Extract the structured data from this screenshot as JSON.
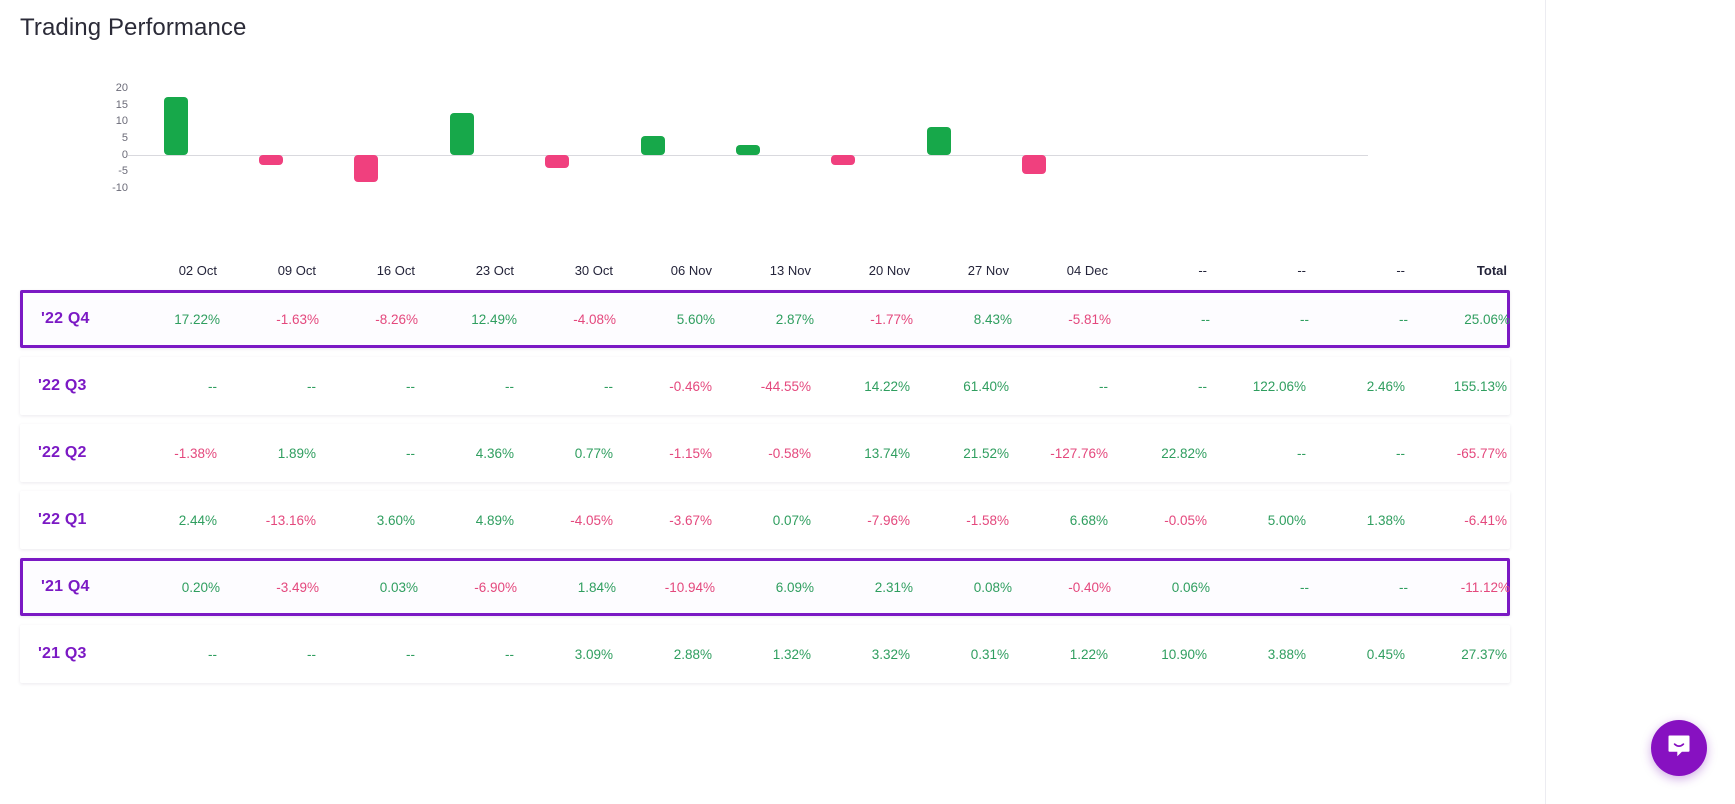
{
  "page": {
    "title": "Trading Performance"
  },
  "colors": {
    "positive": "#2f9e5f",
    "negative": "#e4487d",
    "bar_positive": "#17a84a",
    "bar_negative": "#f0407e",
    "accent_purple": "#7b19c4",
    "row_label": "#7b19c4",
    "intercom": "#8711c1"
  },
  "chat": {
    "launcher_icon": "chat-bubble-smile-icon"
  },
  "table": {
    "columns": [
      "02 Oct",
      "09 Oct",
      "16 Oct",
      "23 Oct",
      "30 Oct",
      "06 Nov",
      "13 Nov",
      "20 Nov",
      "27 Nov",
      "04 Dec",
      "--",
      "--",
      "--"
    ],
    "total_header": "Total",
    "na": "--",
    "rows": [
      {
        "label": "'22 Q4",
        "highlight": true,
        "values": [
          "17.22%",
          "-1.63%",
          "-8.26%",
          "12.49%",
          "-4.08%",
          "5.60%",
          "2.87%",
          "-1.77%",
          "8.43%",
          "-5.81%",
          "--",
          "--",
          "--"
        ],
        "total": "25.06%"
      },
      {
        "label": "'22 Q3",
        "highlight": false,
        "values": [
          "--",
          "--",
          "--",
          "--",
          "--",
          "-0.46%",
          "-44.55%",
          "14.22%",
          "61.40%",
          "--",
          "--",
          "122.06%",
          "2.46%"
        ],
        "total": "155.13%"
      },
      {
        "label": "'22 Q2",
        "highlight": false,
        "values": [
          "-1.38%",
          "1.89%",
          "--",
          "4.36%",
          "0.77%",
          "-1.15%",
          "-0.58%",
          "13.74%",
          "21.52%",
          "-127.76%",
          "22.82%",
          "--",
          "--"
        ],
        "total": "-65.77%"
      },
      {
        "label": "'22 Q1",
        "highlight": false,
        "values": [
          "2.44%",
          "-13.16%",
          "3.60%",
          "4.89%",
          "-4.05%",
          "-3.67%",
          "0.07%",
          "-7.96%",
          "-1.58%",
          "6.68%",
          "-0.05%",
          "5.00%",
          "1.38%"
        ],
        "total": "-6.41%"
      },
      {
        "label": "'21 Q4",
        "highlight": true,
        "values": [
          "0.20%",
          "-3.49%",
          "0.03%",
          "-6.90%",
          "1.84%",
          "-10.94%",
          "6.09%",
          "2.31%",
          "0.08%",
          "-0.40%",
          "0.06%",
          "--",
          "--"
        ],
        "total": "-11.12%"
      },
      {
        "label": "'21 Q3",
        "highlight": false,
        "values": [
          "--",
          "--",
          "--",
          "--",
          "3.09%",
          "2.88%",
          "1.32%",
          "3.32%",
          "0.31%",
          "1.22%",
          "10.90%",
          "3.88%",
          "0.45%"
        ],
        "total": "27.37%"
      }
    ]
  },
  "chart_data": {
    "type": "bar",
    "title": "Trading Performance",
    "xlabel": "",
    "ylabel": "",
    "grid": false,
    "legend": "none",
    "ylim": [
      -10,
      20
    ],
    "yticks": [
      20,
      15,
      10,
      5,
      0,
      -5,
      -10
    ],
    "categories": [
      "02 Oct",
      "09 Oct",
      "16 Oct",
      "23 Oct",
      "30 Oct",
      "06 Nov",
      "13 Nov",
      "20 Nov",
      "27 Nov",
      "04 Dec",
      "--",
      "--",
      "--"
    ],
    "series": [
      {
        "name": "'22 Q4",
        "values": [
          17.22,
          -1.63,
          -8.26,
          12.49,
          -4.08,
          5.6,
          2.87,
          -1.77,
          8.43,
          -5.81,
          null,
          null,
          null
        ]
      }
    ]
  }
}
